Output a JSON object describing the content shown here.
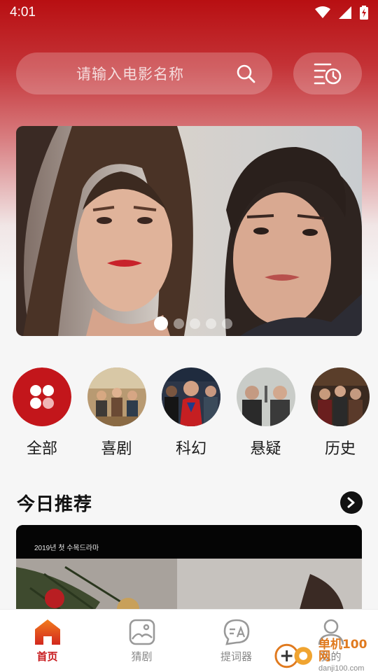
{
  "status_bar": {
    "time": "4:01",
    "icons": [
      "wifi-icon",
      "signal-icon",
      "battery-charging-icon"
    ]
  },
  "search": {
    "placeholder": "请输入电影名称",
    "icon": "search-icon",
    "history_icon": "watch-history-icon"
  },
  "banner": {
    "slide_count": 5,
    "active_index": 0
  },
  "categories": [
    {
      "label": "全部",
      "icon": "grid-icon"
    },
    {
      "label": "喜剧"
    },
    {
      "label": "科幻"
    },
    {
      "label": "悬疑"
    },
    {
      "label": "历史"
    }
  ],
  "recommend": {
    "title": "今日推荐",
    "more_icon": "chevron-right-icon",
    "card_caption": "2019년 첫 수목드라마"
  },
  "tabbar": {
    "items": [
      {
        "label": "首页",
        "icon": "home-icon",
        "active": true
      },
      {
        "label": "猜剧",
        "icon": "image-icon",
        "active": false
      },
      {
        "label": "提词器",
        "icon": "chat-bubble-icon",
        "active": false
      },
      {
        "label": "我的",
        "icon": "user-icon",
        "active": false
      }
    ]
  },
  "watermark": {
    "name": "单机100网",
    "url": "danji100.com"
  },
  "colors": {
    "accent": "#c81b1e",
    "header_red": "#b80f12"
  }
}
